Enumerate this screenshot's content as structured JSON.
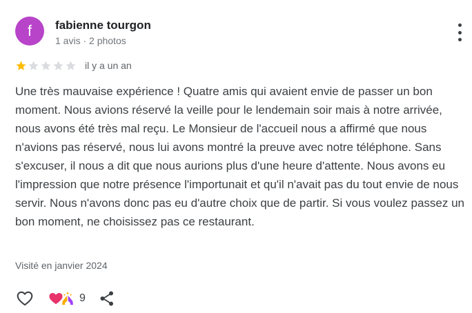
{
  "review": {
    "author": {
      "initial": "f",
      "name": "fabienne tourgon",
      "meta": "1 avis · 2 photos",
      "avatar_color": "#b844c9"
    },
    "rating": {
      "value": 1,
      "max": 5,
      "filled_color": "#fbbc04",
      "empty_color": "#dadce0"
    },
    "date": "il y a un an",
    "text": "Une très mauvaise expérience ! Quatre amis qui avaient envie de passer un bon moment. Nous avions réservé la veille pour le lendemain soir mais à notre arrivée, nous avons été très mal reçu. Le Monsieur de l'accueil nous a affirmé que nous n'avions pas réservé, nous lui avons montré la preuve avec notre téléphone. Sans s'excuser, il nous a dit que nous aurions plus d'une heure d'attente. Nous avons eu l'impression que notre présence l'importunait et qu'il n'avait pas du tout envie de nous servir. Nous n'avons donc pas eu d'autre choix que de partir. Si vous voulez passez un bon moment, ne choisissez pas ce restaurant.",
    "visited": "Visité en janvier 2024",
    "actions": {
      "like_icon": "heart-outline-icon",
      "reaction_icons": [
        "heart-reaction-icon",
        "praying-hands-reaction-icon"
      ],
      "reaction_count": "9",
      "share_icon": "share-icon",
      "more_icon": "more-vertical-icon"
    }
  }
}
